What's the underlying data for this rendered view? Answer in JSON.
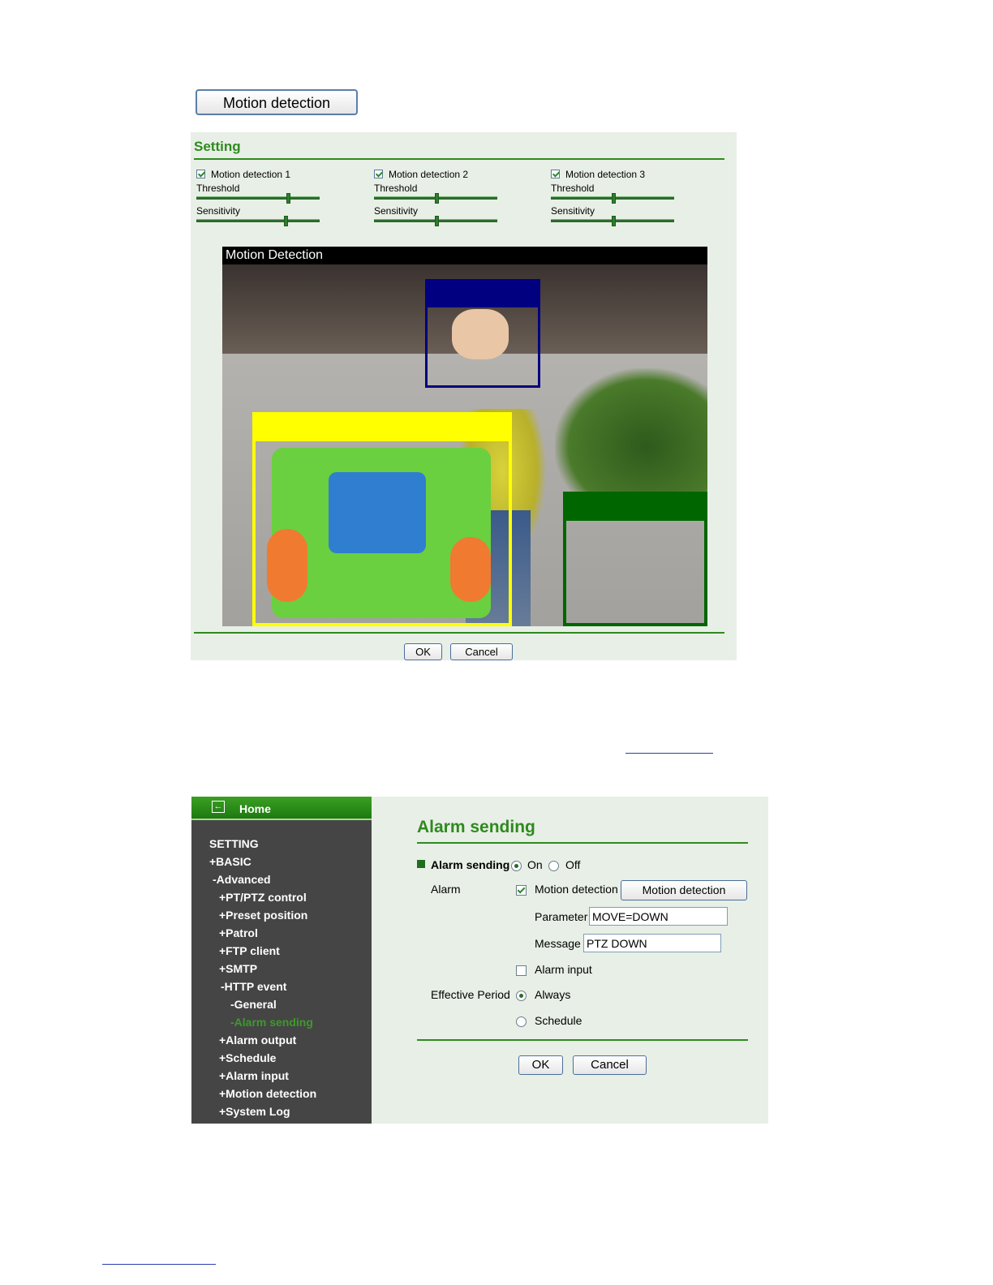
{
  "top_button": {
    "label": "Motion detection"
  },
  "setting_panel": {
    "title": "Setting",
    "detections": [
      {
        "label": "Motion detection 1",
        "checked": true,
        "threshold_label": "Threshold",
        "sensitivity_label": "Sensitivity",
        "threshold_level": 0.74,
        "sensitivity_level": 0.72
      },
      {
        "label": "Motion detection 2",
        "checked": true,
        "threshold_label": "Threshold",
        "sensitivity_label": "Sensitivity",
        "threshold_level": 0.5,
        "sensitivity_level": 0.5
      },
      {
        "label": "Motion detection 3",
        "checked": true,
        "threshold_label": "Threshold",
        "sensitivity_label": "Sensitivity",
        "threshold_level": 0.5,
        "sensitivity_level": 0.5
      }
    ],
    "video_title": "Motion Detection",
    "region_colors": {
      "region1": "#ffff00",
      "region2": "#000080",
      "region3": "#006600"
    },
    "ok_label": "OK",
    "cancel_label": "Cancel"
  },
  "sidebar": {
    "home_label": "Home",
    "home_icon": "back-arrow-icon",
    "items": [
      {
        "label": "SETTING"
      },
      {
        "label": "+BASIC"
      },
      {
        "label": "-Advanced"
      },
      {
        "label": "+PT/PTZ control"
      },
      {
        "label": "+Preset position"
      },
      {
        "label": "+Patrol"
      },
      {
        "label": "+FTP client"
      },
      {
        "label": "+SMTP"
      },
      {
        "label": "-HTTP event"
      },
      {
        "label": "-General"
      },
      {
        "label": "-Alarm sending"
      },
      {
        "label": "+Alarm output"
      },
      {
        "label": "+Schedule"
      },
      {
        "label": "+Alarm input"
      },
      {
        "label": "+Motion detection"
      },
      {
        "label": "+System Log"
      }
    ]
  },
  "alarm": {
    "title": "Alarm sending",
    "alarm_sending_label": "Alarm sending",
    "on_label": "On",
    "off_label": "Off",
    "selected": "On",
    "alarm_label": "Alarm",
    "motion_detection_label": "Motion detection",
    "motion_detection_checked": true,
    "motion_detection_button": "Motion detection",
    "parameter_label": "Parameter",
    "parameter_value": "MOVE=DOWN",
    "message_label": "Message",
    "message_value": "PTZ DOWN",
    "alarm_input_label": "Alarm input",
    "alarm_input_checked": false,
    "effective_period_label": "Effective Period",
    "always_label": "Always",
    "schedule_label": "Schedule",
    "period_selected": "Always",
    "ok_label": "OK",
    "cancel_label": "Cancel"
  }
}
